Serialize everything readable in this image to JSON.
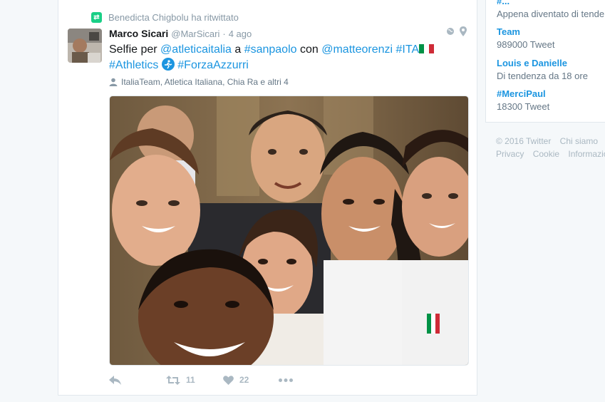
{
  "tweet": {
    "retweet_context": "Benedicta Chigbolu ha ritwittato",
    "fullname": "Marco Sicari",
    "username": "@MarSicari",
    "separator": "·",
    "time": "4 ago",
    "text_segments": {
      "s1": "Selfie per ",
      "s2": "@atleticaitalia",
      "s3": " a ",
      "s4": "#sanpaolo",
      "s5": " con ",
      "s6": "@matteorenzi",
      "s7": " ",
      "s8": "#ITA",
      "s9": "#Athletics",
      "s10": "#ForzaAzzurri"
    },
    "tagged_people": "ItaliaTeam, Atletica Italiana, Chia Ra e altri 4",
    "actions": {
      "retweet_count": "11",
      "like_count": "22"
    },
    "icons": [
      "retweet-icon",
      "globe-icon",
      "location-pin-icon",
      "person-icon",
      "reply-icon",
      "heart-icon",
      "more-icon",
      "italy-flag-icon",
      "runner-icon"
    ]
  },
  "sidebar": {
    "trends": [
      {
        "name": "#...",
        "meta": "Appena diventato di tendenza"
      },
      {
        "name": "Team",
        "meta": "989000 Tweet"
      },
      {
        "name": "Louis e Danielle",
        "meta": "Di tendenza da 18 ore"
      },
      {
        "name": "#MerciPaul",
        "meta": "18300 Tweet"
      }
    ],
    "footer": {
      "copyright": "© 2016 Twitter",
      "about": "Chi siamo",
      "privacy": "Privacy",
      "cookie": "Cookie",
      "info": "Informazioni"
    }
  },
  "colors": {
    "link": "#1b95e0",
    "muted": "#8899a6",
    "retweet_green": "#19cf86",
    "background": "#f5f8fa"
  }
}
